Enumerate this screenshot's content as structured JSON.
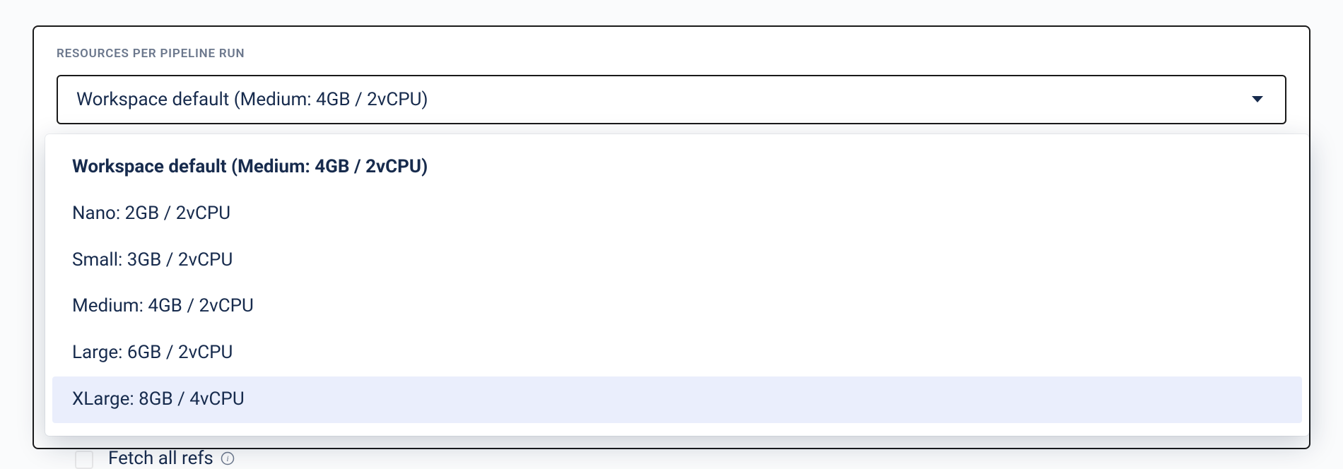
{
  "section": {
    "label": "RESOURCES PER PIPELINE RUN"
  },
  "select": {
    "value": "Workspace default (Medium: 4GB / 2vCPU)"
  },
  "options": [
    {
      "label": "Workspace default (Medium: 4GB / 2vCPU)",
      "selected": true,
      "highlighted": false
    },
    {
      "label": "Nano: 2GB / 2vCPU",
      "selected": false,
      "highlighted": false
    },
    {
      "label": "Small: 3GB / 2vCPU",
      "selected": false,
      "highlighted": false
    },
    {
      "label": "Medium: 4GB / 2vCPU",
      "selected": false,
      "highlighted": false
    },
    {
      "label": "Large: 6GB / 2vCPU",
      "selected": false,
      "highlighted": false
    },
    {
      "label": "XLarge: 8GB / 4vCPU",
      "selected": false,
      "highlighted": true
    }
  ],
  "below": {
    "label": "Fetch all refs"
  }
}
